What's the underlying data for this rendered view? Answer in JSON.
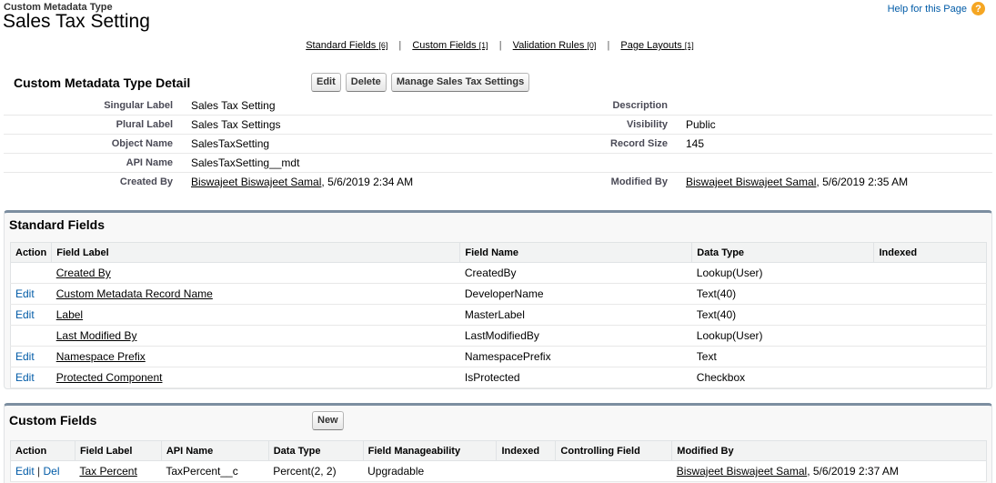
{
  "header": {
    "supertitle": "Custom Metadata Type",
    "title": "Sales Tax Setting",
    "help_label": "Help for this Page",
    "help_icon": "?"
  },
  "related_links": [
    {
      "label": "Standard Fields",
      "count": "[6]"
    },
    {
      "label": "Custom Fields",
      "count": "[1]"
    },
    {
      "label": "Validation Rules",
      "count": "[0]"
    },
    {
      "label": "Page Layouts",
      "count": "[1]"
    }
  ],
  "separator": "|",
  "detail": {
    "title": "Custom Metadata Type Detail",
    "buttons": {
      "edit": "Edit",
      "delete": "Delete",
      "manage": "Manage Sales Tax Settings"
    },
    "rows": [
      {
        "label": "Singular Label",
        "value": "Sales Tax Setting",
        "label2": "Description",
        "value2": ""
      },
      {
        "label": "Plural Label",
        "value": "Sales Tax Settings",
        "label2": "Visibility",
        "value2": "Public"
      },
      {
        "label": "Object Name",
        "value": "SalesTaxSetting",
        "label2": "Record Size",
        "value2": "145"
      },
      {
        "label": "API Name",
        "value": "SalesTaxSetting__mdt",
        "label2": "",
        "value2": ""
      }
    ],
    "created_by": {
      "label": "Created By",
      "user": "Biswajeet Biswajeet Samal",
      "date": ", 5/6/2019 2:34 AM"
    },
    "modified_by": {
      "label": "Modified By",
      "user": "Biswajeet Biswajeet Samal",
      "date": ", 5/6/2019 2:35 AM"
    }
  },
  "standard_fields": {
    "title": "Standard Fields",
    "columns": {
      "action": "Action",
      "field_label": "Field Label",
      "field_name": "Field Name",
      "data_type": "Data Type",
      "indexed": "Indexed"
    },
    "rows": [
      {
        "action": "",
        "label": "Created By",
        "name": "CreatedBy",
        "type": "Lookup(User)",
        "indexed": ""
      },
      {
        "action": "Edit",
        "label": "Custom Metadata Record Name",
        "name": "DeveloperName",
        "type": "Text(40)",
        "indexed": ""
      },
      {
        "action": "Edit",
        "label": "Label",
        "name": "MasterLabel",
        "type": "Text(40)",
        "indexed": ""
      },
      {
        "action": "",
        "label": "Last Modified By",
        "name": "LastModifiedBy",
        "type": "Lookup(User)",
        "indexed": ""
      },
      {
        "action": "Edit",
        "label": "Namespace Prefix",
        "name": "NamespacePrefix",
        "type": "Text",
        "indexed": ""
      },
      {
        "action": "Edit",
        "label": "Protected Component",
        "name": "IsProtected",
        "type": "Checkbox",
        "indexed": ""
      }
    ]
  },
  "custom_fields": {
    "title": "Custom Fields",
    "new_button": "New",
    "columns": {
      "action": "Action",
      "field_label": "Field Label",
      "api_name": "API Name",
      "data_type": "Data Type",
      "manageability": "Field Manageability",
      "indexed": "Indexed",
      "controlling": "Controlling Field",
      "modified_by": "Modified By"
    },
    "rows": [
      {
        "edit": "Edit",
        "sep": " | ",
        "del": "Del",
        "label": "Tax Percent",
        "api": "TaxPercent__c",
        "type": "Percent(2, 2)",
        "manageability": "Upgradable",
        "indexed": "",
        "controlling": "",
        "modified_user": "Biswajeet Biswajeet Samal",
        "modified_date": ", 5/6/2019 2:37 AM"
      }
    ]
  }
}
